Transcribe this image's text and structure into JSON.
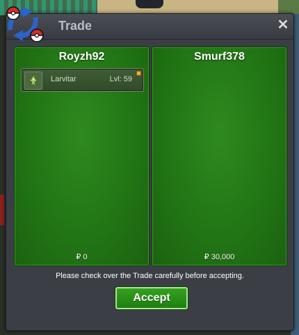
{
  "window": {
    "title": "Trade",
    "close_symbol": "✕"
  },
  "trade": {
    "left": {
      "player": "Royzh92",
      "money": "₽ 0",
      "pokemon": [
        {
          "name": "Larvitar",
          "level": "Lvl: 59",
          "icon": "larvitar-icon"
        }
      ]
    },
    "right": {
      "player": "Smurf378",
      "money": "₽ 30,000",
      "pokemon": []
    }
  },
  "notice": "Please check over the Trade carefully before accepting.",
  "accept_label": "Accept",
  "colors": {
    "panel_green": "#227515",
    "button_green": "#2a9318",
    "window_bg": "#3b3f45"
  }
}
